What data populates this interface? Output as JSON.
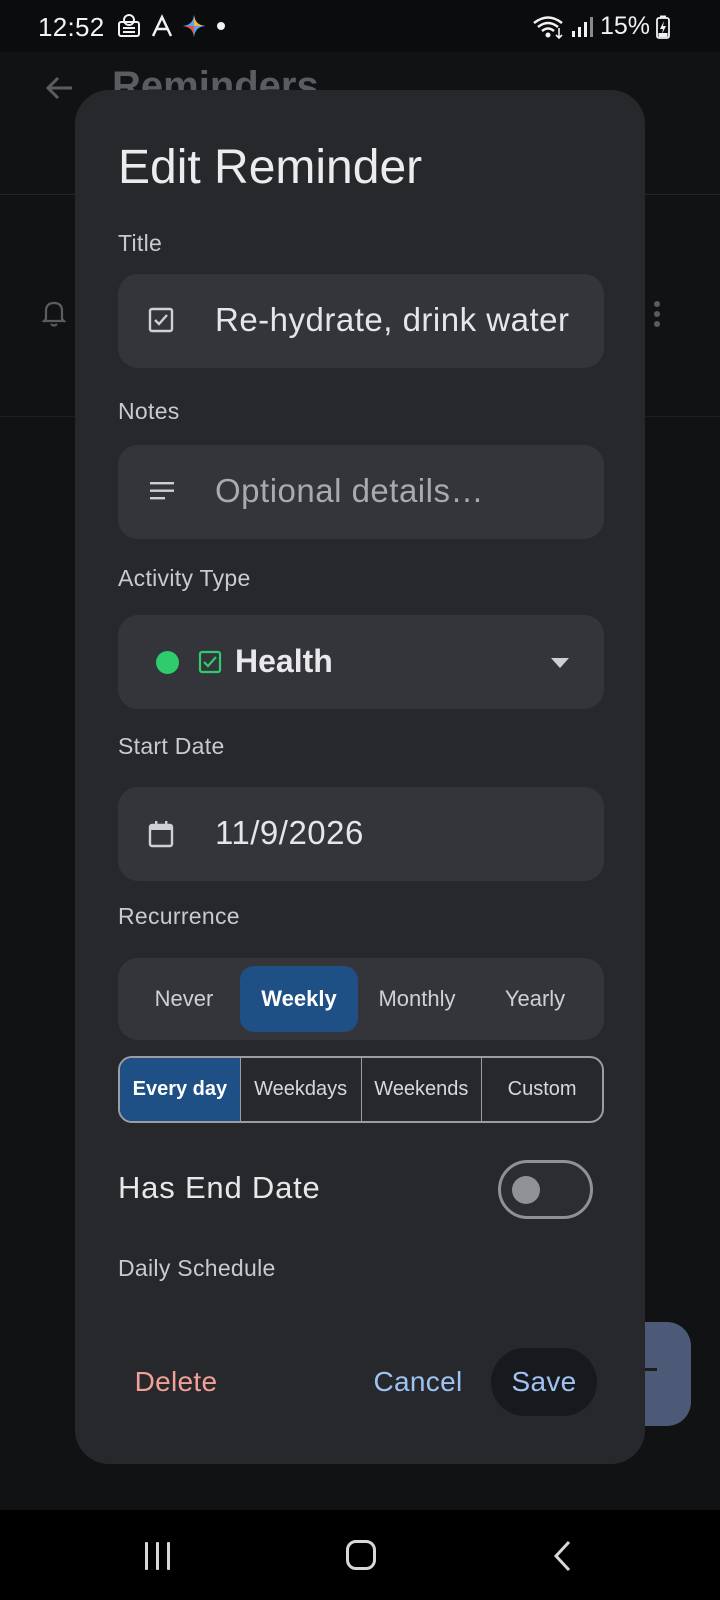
{
  "status_bar": {
    "time": "12:52",
    "battery": "15%",
    "icons": [
      "notification-icon",
      "font-app-icon",
      "gemini-icon",
      "dot-icon",
      "wifi-icon",
      "signal-icon",
      "battery-charging-icon"
    ]
  },
  "background_screen": {
    "title": "Reminders"
  },
  "dialog": {
    "title": "Edit Reminder",
    "title_field": {
      "label": "Title",
      "value": "Re-hydrate, drink water",
      "icon": "checkbox-icon"
    },
    "notes_field": {
      "label": "Notes",
      "placeholder": "Optional details…",
      "icon": "notes-lines-icon"
    },
    "activity_type": {
      "label": "Activity Type",
      "value": "Health",
      "dot_color": "#2ecc6d",
      "icon": "checkbox-icon"
    },
    "start_date": {
      "label": "Start Date",
      "value": "11/9/2026",
      "icon": "calendar-icon"
    },
    "recurrence": {
      "label": "Recurrence",
      "options": [
        "Never",
        "Weekly",
        "Monthly",
        "Yearly"
      ],
      "selected": "Weekly"
    },
    "day_pattern": {
      "options": [
        "Every day",
        "Weekdays",
        "Weekends",
        "Custom"
      ],
      "selected": "Every day"
    },
    "has_end_date": {
      "label": "Has End Date",
      "on": false
    },
    "daily_schedule": {
      "label": "Daily Schedule"
    },
    "buttons": {
      "delete": "Delete",
      "cancel": "Cancel",
      "save": "Save"
    }
  },
  "colors": {
    "accent": "#1e4f85",
    "dialog_bg": "#26282c",
    "field_bg": "#33353a",
    "danger_text": "#f2a097",
    "action_text": "#9fc2f5"
  }
}
